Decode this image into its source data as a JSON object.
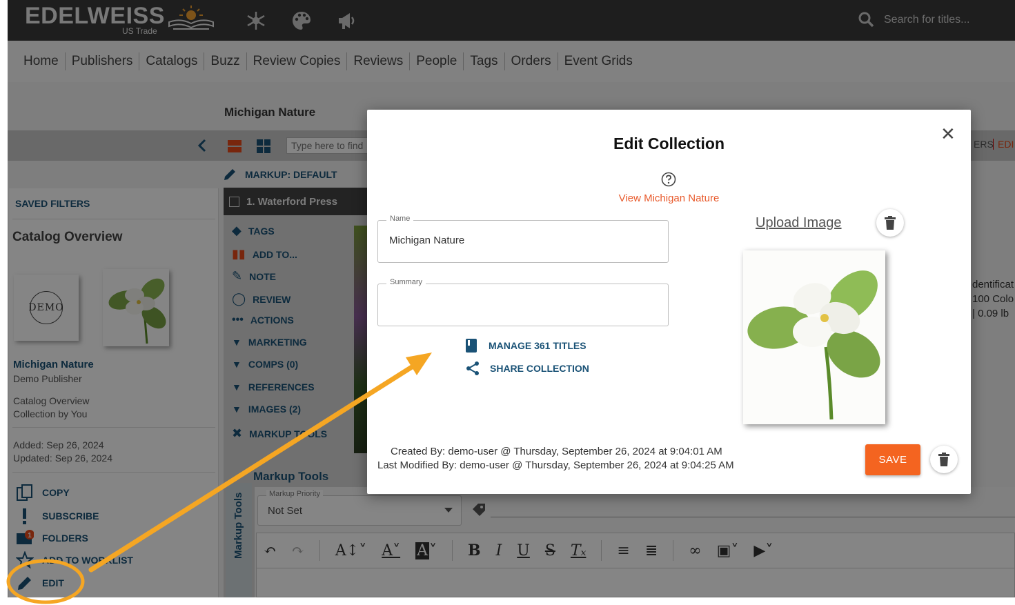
{
  "header": {
    "logo_text": "EDELWEISS",
    "logo_sub": "US Trade",
    "search_placeholder": "Search for titles..."
  },
  "nav": {
    "items": [
      "Home",
      "Publishers",
      "Catalogs",
      "Buzz",
      "Review Copies",
      "Reviews",
      "People",
      "Tags",
      "Orders",
      "Event Grids"
    ]
  },
  "page": {
    "catalog_title": "Michigan Nature",
    "find_placeholder": "Type here to find",
    "markup_default": "MARKUP: DEFAULT",
    "right_tab_partial": "ERS",
    "right_tab_edit": "EDI"
  },
  "sidebar": {
    "saved_filters": "SAVED FILTERS",
    "catalog_overview": "Catalog Overview",
    "demo_label": "DEMO",
    "name": "Michigan Nature",
    "publisher": "Demo Publisher",
    "type_line1": "Catalog Overview",
    "type_line2": "Collection by You",
    "added": "Added: Sep 26, 2024",
    "updated": "Updated: Sep 26, 2024",
    "actions": {
      "copy": "COPY",
      "subscribe": "SUBSCRIBE",
      "folders": "FOLDERS",
      "folders_badge": "1",
      "add_to_worklist": "ADD TO WORKLIST",
      "edit": "EDIT"
    }
  },
  "title_panel": {
    "header": "1. Waterford Press",
    "items": [
      "TAGS",
      "ADD TO...",
      "NOTE",
      "REVIEW",
      "ACTIONS",
      "MARKETING",
      "COMPS (0)",
      "REFERENCES",
      "IMAGES (2)",
      "MARKUP TOOLS"
    ]
  },
  "right_partial": {
    "line1": "dentificat",
    "line2": "100 Colo",
    "line3": "| 0.09 lb"
  },
  "markup_tools": {
    "title": "Markup Tools",
    "vertical_label": "Markup Tools",
    "priority_label": "Markup Priority",
    "priority_value": "Not Set"
  },
  "modal": {
    "title": "Edit Collection",
    "view_link": "View Michigan Nature",
    "name_label": "Name",
    "name_value": "Michigan Nature",
    "summary_label": "Summary",
    "summary_value": "",
    "manage_titles": "MANAGE 361 TITLES",
    "share_collection": "SHARE COLLECTION",
    "upload_image": "Upload Image",
    "created_by": "Created By: demo-user @ Thursday, September 26, 2024 at 9:04:01 AM",
    "modified_by": "Last Modified By: demo-user @ Thursday, September 26, 2024 at 9:04:25 AM",
    "save_label": "SAVE"
  },
  "colors": {
    "accent_orange": "#f46420",
    "link_blue": "#1a5276",
    "annotation_yellow": "#f5a623"
  }
}
